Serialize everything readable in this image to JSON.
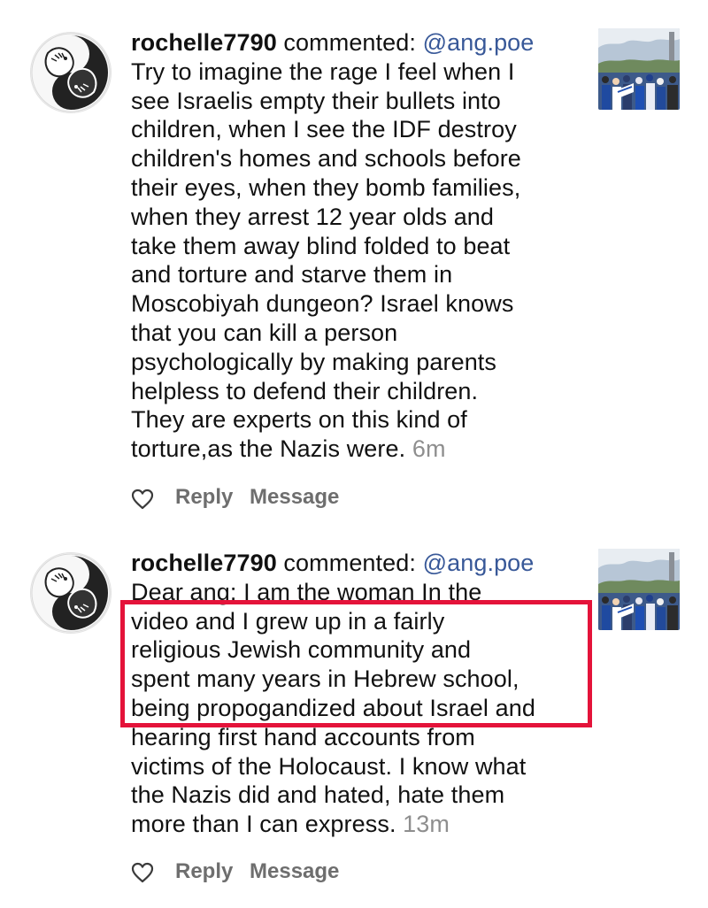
{
  "colors": {
    "mention": "#385898",
    "timestamp": "#8e8e8e",
    "action_text": "#6e6e6e",
    "highlight_border": "#e4133a"
  },
  "notifications": [
    {
      "username": "rochelle7790",
      "verb": "commented:",
      "mention": "@ang.poe",
      "lines": [
        "Try to imagine the rage I feel when I",
        "see Israelis empty their bullets into",
        "children, when I see the IDF destroy",
        "children's homes and schools before",
        "their eyes, when they bomb families,",
        "when they arrest 12 year olds and",
        "take them away blind folded to beat",
        "and torture and starve them in",
        "Moscobiyah dungeon? Israel knows",
        "that you can kill a person",
        "psychologically by making parents",
        "helpless to defend their children.",
        "They are experts on this kind of",
        "torture,as the Nazis were."
      ],
      "time": "6m",
      "reply_label": "Reply",
      "message_label": "Message",
      "avatar_icon": "koi-fish-yin-yang-icon",
      "thumbnail_icon": "crowd-protest-photo"
    },
    {
      "username": "rochelle7790",
      "verb": "commented:",
      "mention": "@ang.poe",
      "lines": [
        "Dear ang:  I am the woman  In the",
        "video and I grew up in a fairly",
        "religious Jewish community and",
        "spent many years in Hebrew school,",
        "being propogandized about Israel and",
        "hearing first hand accounts from",
        "victims of the Holocaust.  I know what",
        "the Nazis did and hated, hate them",
        "more than I can express."
      ],
      "time": "13m",
      "reply_label": "Reply",
      "message_label": "Message",
      "avatar_icon": "koi-fish-yin-yang-icon",
      "thumbnail_icon": "crowd-protest-photo"
    }
  ]
}
